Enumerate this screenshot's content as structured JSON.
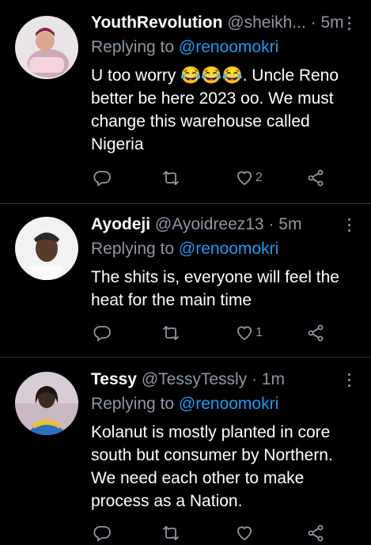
{
  "tweets": [
    {
      "name": "YouthRevolution",
      "handle": "@sheikh...",
      "time": "· 5m",
      "replying_prefix": "Replying to",
      "replying_to": "@renoomokri",
      "text": "U too worry 😂😂😂. Uncle Reno better be here 2023 oo. We must change this warehouse called Nigeria",
      "likes": "2"
    },
    {
      "name": "Ayodeji",
      "handle": "@Ayoidreez13",
      "time": "· 5m",
      "replying_prefix": "Replying to",
      "replying_to": "@renoomokri",
      "text": "The shits is, everyone will feel the heat for the main time",
      "likes": "1"
    },
    {
      "name": "Tessy",
      "handle": "@TessyTessly",
      "time": "· 1m",
      "replying_prefix": "Replying to",
      "replying_to": "@renoomokri",
      "text": "Kolanut  is mostly planted in core south but consumer by Northern. We need each other to make process as a Nation.",
      "likes": ""
    }
  ],
  "icons": [
    "reply-icon",
    "retweet-icon",
    "like-icon",
    "share-icon",
    "more-icon"
  ],
  "colors": {
    "background": "#000000",
    "secondary_text": "#8b98a5",
    "link": "#1d9bf0",
    "divider": "#2f3336"
  }
}
